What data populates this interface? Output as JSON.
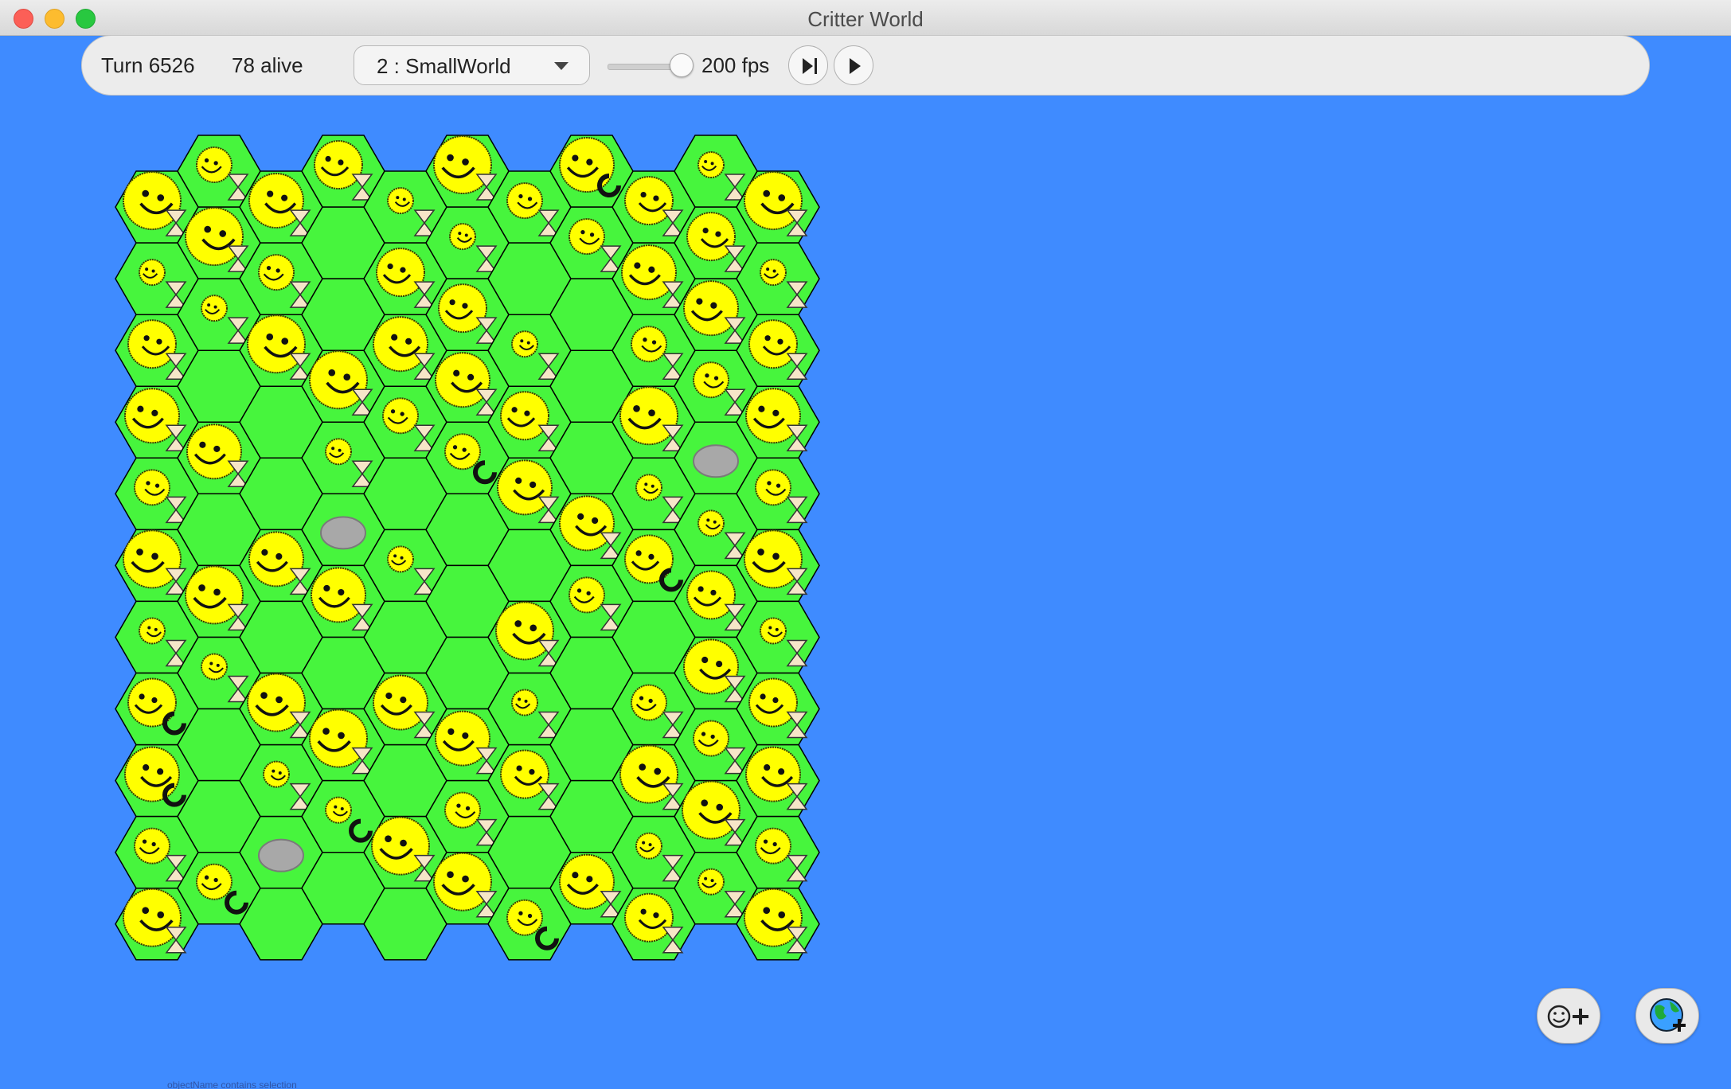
{
  "window": {
    "title": "Critter World"
  },
  "toolbar": {
    "turn_text": "Turn 6526",
    "alive_text": "78 alive",
    "world_selected": "2 : SmallWorld",
    "speed_value": 200,
    "fps_text": "200 fps",
    "step_icon": "step-forward-icon",
    "play_icon": "play-icon"
  },
  "world": {
    "columns": 11,
    "rows": 11,
    "cell_fill": "#47f53d",
    "cell_stroke": "#000000",
    "critter_color": "#ffff00",
    "rock_color": "#a8a8a8",
    "rocks": [
      [
        9,
        4
      ],
      [
        3,
        5
      ],
      [
        2,
        9
      ]
    ],
    "empty_cells": [
      [
        3,
        1
      ],
      [
        6,
        1
      ],
      [
        3,
        2
      ],
      [
        7,
        2
      ],
      [
        1,
        3
      ],
      [
        2,
        3
      ],
      [
        7,
        3
      ],
      [
        2,
        4
      ],
      [
        4,
        4
      ],
      [
        7,
        4
      ],
      [
        1,
        5
      ],
      [
        5,
        5
      ],
      [
        6,
        5
      ],
      [
        2,
        6
      ],
      [
        4,
        6
      ],
      [
        5,
        6
      ],
      [
        8,
        6
      ],
      [
        3,
        7
      ],
      [
        5,
        7
      ],
      [
        7,
        7
      ],
      [
        1,
        8
      ],
      [
        4,
        8
      ],
      [
        7,
        8
      ],
      [
        1,
        9
      ],
      [
        6,
        9
      ],
      [
        7,
        9
      ],
      [
        2,
        10
      ],
      [
        4,
        10
      ],
      [
        3,
        10
      ],
      [
        4,
        11
      ]
    ],
    "spin_marker_cells": [
      [
        7,
        0
      ],
      [
        5,
        4
      ],
      [
        6,
        5
      ],
      [
        8,
        5
      ],
      [
        0,
        7
      ],
      [
        0,
        8
      ],
      [
        3,
        9
      ],
      [
        6,
        10
      ],
      [
        1,
        10
      ]
    ]
  },
  "fabs": {
    "add_critter_icon": "add-critter-icon",
    "add_world_icon": "add-world-icon"
  },
  "footer": {
    "strip_text": "objectName contains selection"
  }
}
